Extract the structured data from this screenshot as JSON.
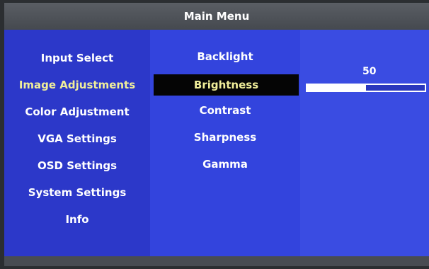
{
  "title": "Main Menu",
  "left_menu": [
    {
      "label": "Input Select"
    },
    {
      "label": "Image Adjustments"
    },
    {
      "label": "Color Adjustment"
    },
    {
      "label": "VGA Settings"
    },
    {
      "label": "OSD Settings"
    },
    {
      "label": "System Settings"
    },
    {
      "label": "Info"
    }
  ],
  "left_active_index": 1,
  "sub_menu": [
    {
      "label": "Backlight"
    },
    {
      "label": "Brightness"
    },
    {
      "label": "Contrast"
    },
    {
      "label": "Sharpness"
    },
    {
      "label": "Gamma"
    }
  ],
  "sub_active_index": 1,
  "brightness": {
    "value_text": "50",
    "fraction": 0.5
  },
  "colors": {
    "highlight_text": "#f0ee9a",
    "selection_bg": "#050505",
    "panel_blue": "#3344dd"
  }
}
